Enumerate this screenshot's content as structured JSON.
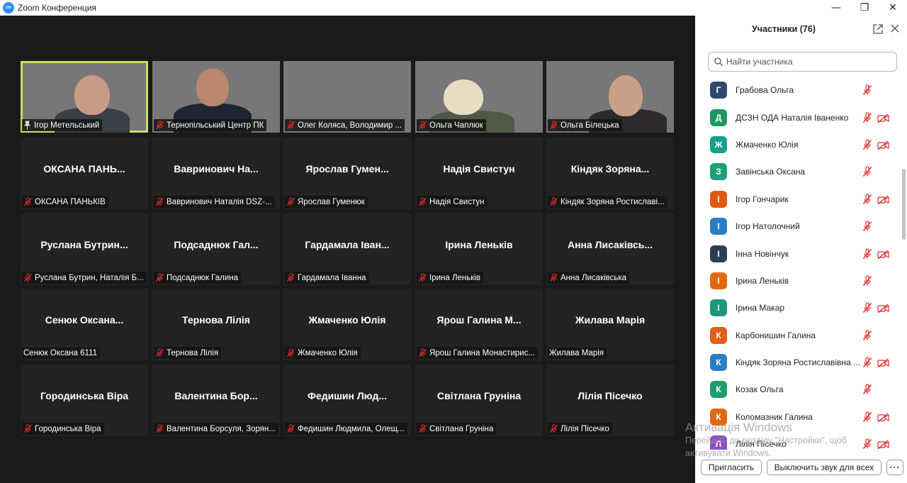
{
  "window": {
    "title": "Zoom Конференция",
    "logo_text": "zm",
    "minimize": "—",
    "maximize": "❐",
    "close": "✕"
  },
  "tiles": [
    {
      "label": "Ігор Метельський",
      "display": "",
      "video": true,
      "active": true,
      "pinned": true,
      "muted": false
    },
    {
      "label": "Тернопільський Центр ПК",
      "display": "",
      "video": true,
      "muted": true
    },
    {
      "label": "Олег Коляса, Володимир ...",
      "display": "",
      "video": true,
      "muted": true
    },
    {
      "label": "Ольга Чаплюк",
      "display": "",
      "video": true,
      "muted": true
    },
    {
      "label": "Ольга Білецька",
      "display": "",
      "video": true,
      "muted": true
    },
    {
      "label": "ОКСАНА ПАНЬКІВ",
      "display": "ОКСАНА ПАНЬ...",
      "muted": true
    },
    {
      "label": "Вавринович Наталія DSZ-...",
      "display": "Вавринович На...",
      "muted": true
    },
    {
      "label": "Ярослав Гуменюк",
      "display": "Ярослав Гумен...",
      "muted": true
    },
    {
      "label": "Надія Свистун",
      "display": "Надія Свистун",
      "muted": true
    },
    {
      "label": "Кіндяк Зоряна Ростиславі...",
      "display": "Кіндяк Зоряна...",
      "muted": true
    },
    {
      "label": "Руслана Бутрин, Наталія Б...",
      "display": "Руслана Бутрин...",
      "muted": true
    },
    {
      "label": "Подсаднюк Галина",
      "display": "Подсаднюк Гал...",
      "muted": true
    },
    {
      "label": "Гардамала Іванна",
      "display": "Гардамала Іван...",
      "muted": true
    },
    {
      "label": "Ірина Леньків",
      "display": "Ірина Леньків",
      "muted": true
    },
    {
      "label": "Анна Лисаківська",
      "display": "Анна Лисаківсь...",
      "muted": true
    },
    {
      "label": "Сенюк Оксана 6111",
      "display": "Сенюк Оксана...",
      "muted": false
    },
    {
      "label": "Тернова Лілія",
      "display": "Тернова Лілія",
      "muted": true
    },
    {
      "label": "Жмаченко Юлія",
      "display": "Жмаченко Юлія",
      "muted": true
    },
    {
      "label": "Ярош Галина Монастирис...",
      "display": "Ярош Галина М...",
      "muted": true
    },
    {
      "label": "Жилава Марія",
      "display": "Жилава Марія",
      "muted": false
    },
    {
      "label": "Городинська Віра",
      "display": "Городинська Віра",
      "muted": true
    },
    {
      "label": "Валентина Борсуля, Зорян...",
      "display": "Валентина Бор...",
      "muted": true
    },
    {
      "label": "Федишин Людмила, Олещ...",
      "display": "Федишин Люд...",
      "muted": true
    },
    {
      "label": "Світлана Груніна",
      "display": "Світлана Груніна",
      "muted": true
    },
    {
      "label": "Лілія Пісечко",
      "display": "Лілія Пісечко",
      "muted": true
    }
  ],
  "panel": {
    "title": "Участники (76)",
    "search_placeholder": "Найти участника",
    "participants": [
      {
        "initial": "Г",
        "name": "Грабова Ольга",
        "color": "#2f4a6b",
        "cam_off": false
      },
      {
        "initial": "Д",
        "name": "ДСЗН ОДА Наталія Іваненко",
        "color": "#1a9a62",
        "cam_off": true
      },
      {
        "initial": "Ж",
        "name": "Жмаченко Юлія",
        "color": "#16a08a",
        "cam_off": true
      },
      {
        "initial": "З",
        "name": "Завінська Оксана",
        "color": "#1ea07a",
        "cam_off": false
      },
      {
        "initial": "І",
        "name": "Ігор Гончарик",
        "color": "#e05a12",
        "cam_off": true
      },
      {
        "initial": "І",
        "name": "Ігор Натолочний",
        "color": "#2a7dc4",
        "cam_off": false
      },
      {
        "initial": "І",
        "name": "Інна Новінчук",
        "color": "#2c3e55",
        "cam_off": true
      },
      {
        "initial": "І",
        "name": "Ірина Леньків",
        "color": "#e06a12",
        "cam_off": false
      },
      {
        "initial": "І",
        "name": "Ірина Макар",
        "color": "#1a9a76",
        "cam_off": true
      },
      {
        "initial": "К",
        "name": "Карбонишин Галина",
        "color": "#e0601a",
        "cam_off": false
      },
      {
        "initial": "К",
        "name": "Кіндяк Зоряна Ростиславівна ...",
        "color": "#2a7dc4",
        "cam_off": true
      },
      {
        "initial": "К",
        "name": "Козак Ольга",
        "color": "#1aa06a",
        "cam_off": false
      },
      {
        "initial": "К",
        "name": "Коломазник Галина",
        "color": "#e06a12",
        "cam_off": true
      },
      {
        "initial": "Л",
        "name": "Лілія Пісечко",
        "color": "#8e4dc9",
        "cam_off": true
      }
    ],
    "invite_label": "Пригласить",
    "mute_all_label": "Выключить звук для всех",
    "more_label": "···"
  },
  "watermark": {
    "line1": "Активація Windows",
    "line2": "Перейдіть до розділу \"Настройки\", щоб",
    "line3": "активувати Windows."
  },
  "colors": {
    "active_speaker": "#c4e16a",
    "muted_red": "#e02a2a",
    "accent": "#2d8cff"
  }
}
